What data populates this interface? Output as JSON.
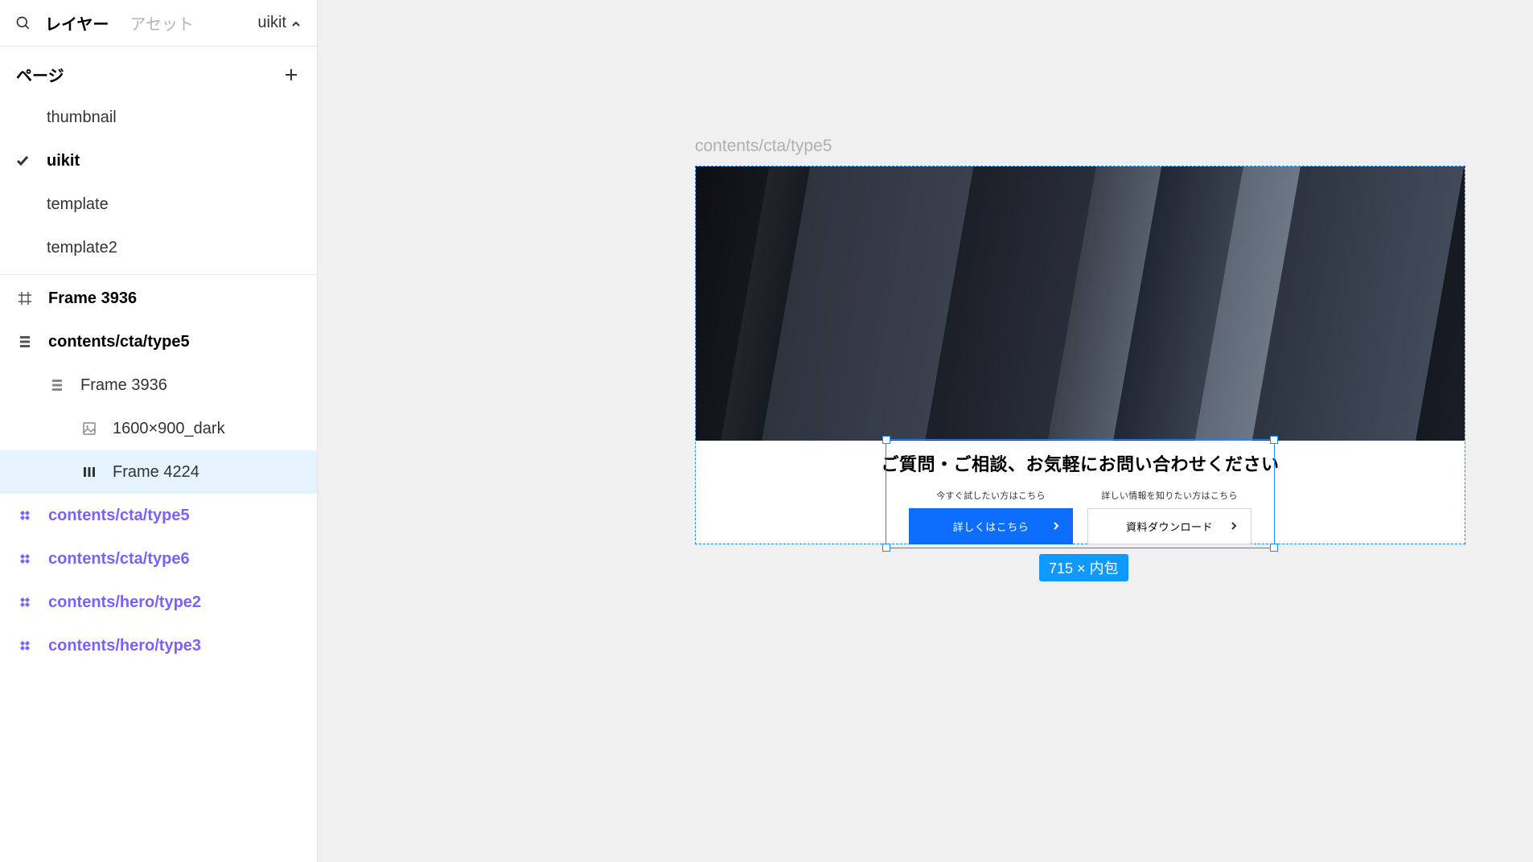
{
  "sidebar": {
    "tab_layers": "レイヤー",
    "tab_assets": "アセット",
    "page_dropdown": "uikit",
    "pages_label": "ページ",
    "pages": [
      {
        "label": "thumbnail",
        "current": false
      },
      {
        "label": "uikit",
        "current": true
      },
      {
        "label": "template",
        "current": false
      },
      {
        "label": "template2",
        "current": false
      }
    ],
    "layers": [
      {
        "label": "Frame 3936",
        "icon": "frame",
        "depth": 0,
        "bold": true
      },
      {
        "label": "contents/cta/type5",
        "icon": "autolayout-v",
        "depth": 0,
        "bold": true
      },
      {
        "label": "Frame 3936",
        "icon": "autolayout-v",
        "depth": 1,
        "bold": false
      },
      {
        "label": "1600×900_dark",
        "icon": "image",
        "depth": 2,
        "bold": false
      },
      {
        "label": "Frame 4224",
        "icon": "autolayout-h",
        "depth": 2,
        "bold": false,
        "selected": true
      },
      {
        "label": "contents/cta/type5",
        "icon": "component",
        "depth": 0,
        "component": true
      },
      {
        "label": "contents/cta/type6",
        "icon": "component",
        "depth": 0,
        "component": true
      },
      {
        "label": "contents/hero/type2",
        "icon": "component",
        "depth": 0,
        "component": true
      },
      {
        "label": "contents/hero/type3",
        "icon": "component",
        "depth": 0,
        "component": true
      }
    ]
  },
  "canvas": {
    "frame_label": "contents/cta/type5",
    "cta": {
      "title": "ご質問・ご相談、お気軽にお問い合わせください",
      "left": {
        "hint": "今すぐ試したい方はこちら",
        "button": "詳しくはこちら"
      },
      "right": {
        "hint": "詳しい情報を知りたい方はこちら",
        "button": "資料ダウンロード"
      }
    },
    "selection_dim": "715 × 内包"
  }
}
